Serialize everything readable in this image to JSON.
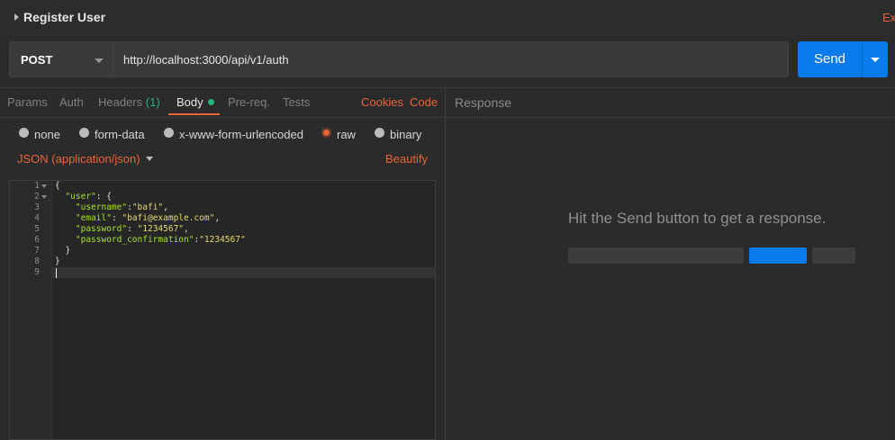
{
  "request": {
    "title": "Register User",
    "examples_label": "Ex",
    "method": "POST",
    "url": "http://localhost:3000/api/v1/auth",
    "send_label": "Send"
  },
  "tabs": {
    "params": "Params",
    "auth": "Auth",
    "headers": "Headers",
    "headers_count": "(1)",
    "body": "Body",
    "prereq": "Pre-req.",
    "tests": "Tests",
    "cookies": "Cookies",
    "code": "Code"
  },
  "body_modes": {
    "none": "none",
    "form_data": "form-data",
    "urlencoded": "x-www-form-urlencoded",
    "raw": "raw",
    "binary": "binary",
    "selected": "raw"
  },
  "content_type": "JSON (application/json)",
  "beautify_label": "Beautify",
  "editor": {
    "line_numbers": [
      "1",
      "2",
      "3",
      "4",
      "5",
      "6",
      "7",
      "8",
      "9"
    ],
    "lines": {
      "l1": "{",
      "l2_key": "\"user\"",
      "l2_rest": ": {",
      "l3_key": "\"username\"",
      "l3_sep": ":",
      "l3_val": "\"bafi\"",
      "l3_end": ",",
      "l4_key": "\"email\"",
      "l4_sep": ": ",
      "l4_val": "\"bafi@example.com\"",
      "l4_end": ",",
      "l5_key": "\"password\"",
      "l5_sep": ": ",
      "l5_val": "\"1234567\"",
      "l5_end": ",",
      "l6_key": "\"password_confirmation\"",
      "l6_sep": ":",
      "l6_val": "\"1234567\"",
      "l7": "}",
      "l8": "}"
    }
  },
  "response": {
    "label": "Response",
    "hint": "Hit the Send button to get a response."
  },
  "colors": {
    "accent": "#e8643a",
    "send_blue": "#097bed",
    "success_green": "#26b47f"
  }
}
